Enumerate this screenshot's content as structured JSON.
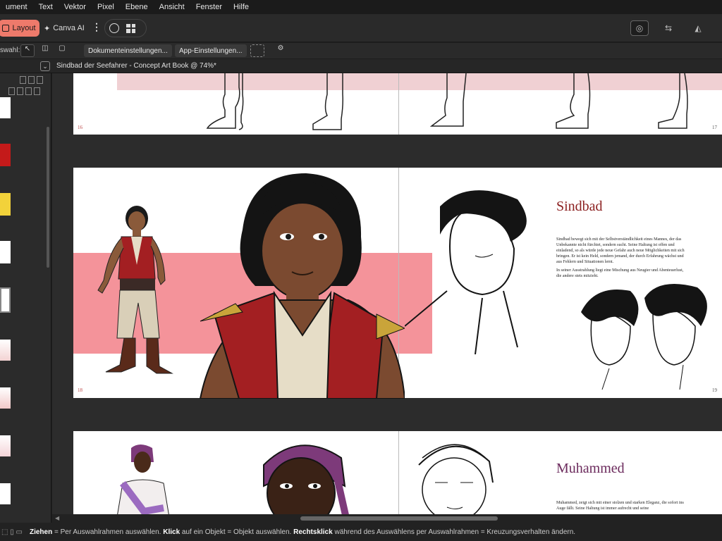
{
  "menu": [
    "ument",
    "Text",
    "Vektor",
    "Pixel",
    "Ebene",
    "Ansicht",
    "Fenster",
    "Hilfe"
  ],
  "toolbar": {
    "layout_label": "Layout",
    "canva_label": "Canva AI",
    "selection_label": "swahl:",
    "doc_settings_label": "Dokumenteinstellungen...",
    "app_settings_label": "App-Einstellungen..."
  },
  "document": {
    "tab_title": "Sindbad der Seefahrer - Concept Art Book @ 74%*"
  },
  "spreads": [
    {
      "left_page": "16",
      "right_page": "17"
    },
    {
      "left_page": "18",
      "right_page": "19",
      "heading": "Sindbad",
      "para1": "Sindbad bewegt sich mit der Selbstverständlichkeit eines Mannes, der das Unbekannte nicht fürchtet, sondern sucht. Seine Haltung ist offen und einladend, so als würde jede neue Gefahr auch neue Möglichkeiten mit sich bringen. Er ist kein Held, sondern jemand, der durch Erfahrung wächst und aus Fehlern und Situationen lernt.",
      "para2": "In seiner Ausstrahlung liegt eine Mischung aus Neugier und Abenteuerlust, die andere stets mitzieht."
    },
    {
      "heading": "Muhammed",
      "para1": "Muhammed, zeigt sich mit einer stolzen und starken Eleganz, die sofort ins Auge fällt. Seine Haltung ist immer aufrecht und seine"
    }
  ],
  "status": {
    "drag": "Ziehen",
    "drag_text": " = Per Auswahlrahmen auswählen. ",
    "click": "Klick",
    "click_text": " auf ein Objekt = Objekt auswählen. ",
    "rclick": "Rechtsklick",
    "rclick_text": " während des Auswählens per Auswahlrahmen = Kreuzungsverhalten ändern."
  },
  "colors": {
    "accent": "#ee7a6b",
    "heading_sindbad": "#8b1f1f",
    "heading_muhammed": "#6b2a5c",
    "pink_band": "#f4939a"
  }
}
